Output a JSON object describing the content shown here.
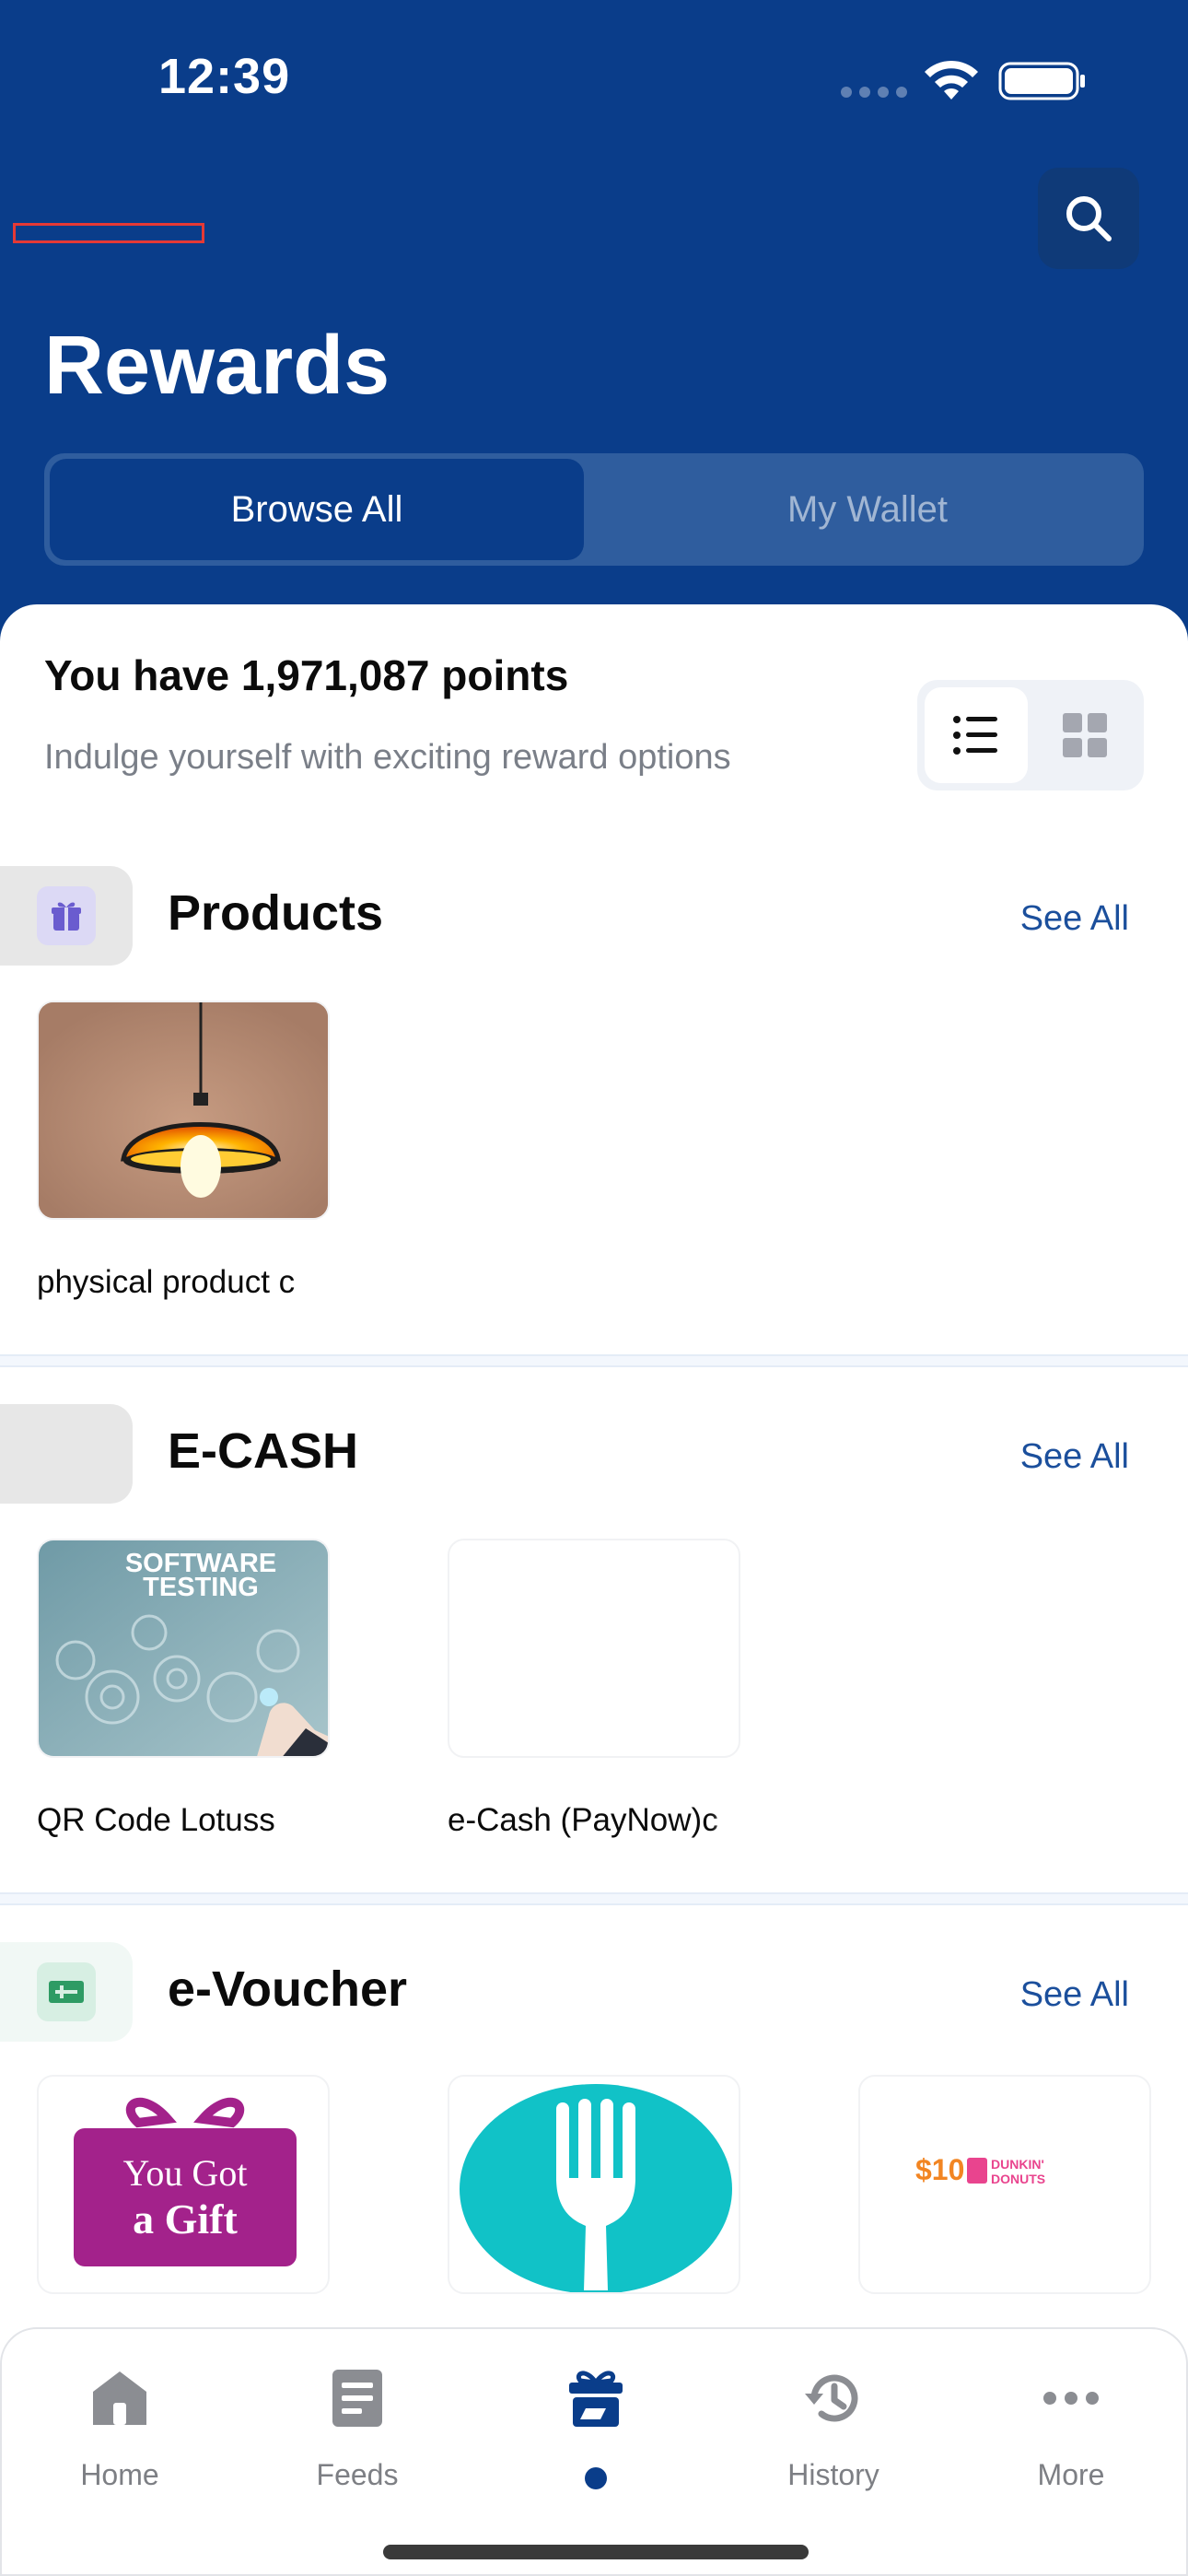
{
  "status_bar": {
    "time": "12:39"
  },
  "header": {
    "title": "Rewards",
    "search_icon": "search-icon",
    "tabs": [
      {
        "label": "Browse All",
        "active": true
      },
      {
        "label": "My Wallet",
        "active": false
      }
    ]
  },
  "points": {
    "title": "You have 1,971,087 points",
    "subtitle": "Indulge yourself with exciting reward options"
  },
  "view_toggle": {
    "options": [
      "list-view-icon",
      "grid-view-icon"
    ],
    "selected": "list-view-icon"
  },
  "sections": [
    {
      "title": "Products",
      "see_all": "See All",
      "icon": "gift-icon",
      "items": [
        {
          "label": "physical product c",
          "image": "pendant-lamp"
        }
      ]
    },
    {
      "title": "E-CASH",
      "see_all": "See All",
      "items": [
        {
          "label": "QR Code Lotuss",
          "image": "software-testing",
          "image_text": [
            "SOFTWARE",
            "TESTING"
          ]
        },
        {
          "label": "e-Cash (PayNow)c",
          "image": "blank"
        }
      ]
    },
    {
      "title": "e-Voucher",
      "see_all": "See All",
      "icon": "voucher-icon",
      "items": [
        {
          "image": "gift-card",
          "image_text": [
            "You Got",
            "a Gift"
          ]
        },
        {
          "image": "fork-logo"
        },
        {
          "image": "dunkin-voucher",
          "image_text": [
            "$10",
            "DUNKIN'",
            "DONUTS"
          ]
        }
      ]
    }
  ],
  "tabbar": {
    "items": [
      {
        "label": "Home",
        "icon": "home-icon"
      },
      {
        "label": "Feeds",
        "icon": "feeds-icon"
      },
      {
        "label": "",
        "icon": "rewards-gift-icon",
        "active": true
      },
      {
        "label": "History",
        "icon": "history-icon"
      },
      {
        "label": "More",
        "icon": "more-icon"
      }
    ]
  },
  "colors": {
    "brand_blue": "#0a3d8a",
    "link_blue": "#1b4f9c",
    "muted_text": "#7a7f88",
    "tab_inactive": "#7d7f84"
  }
}
